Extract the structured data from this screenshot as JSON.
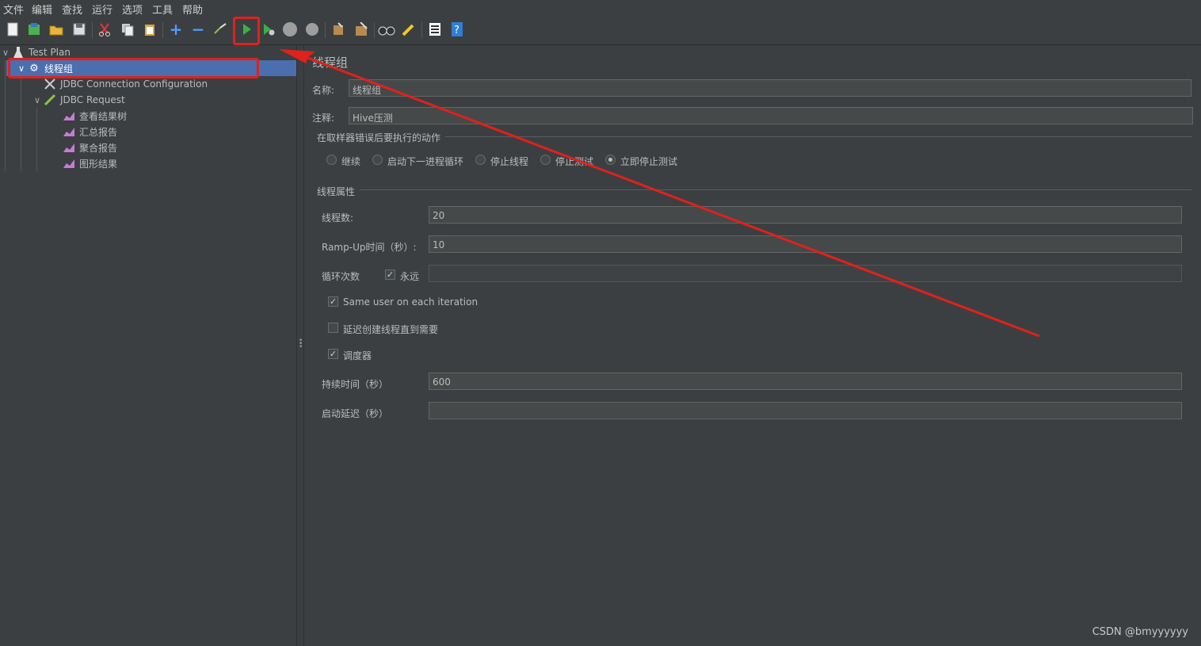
{
  "menu": [
    "文件",
    "编辑",
    "查找",
    "运行",
    "选项",
    "工具",
    "帮助"
  ],
  "tree": {
    "root": "Test Plan",
    "thread_group": "线程组",
    "jdbc_config": "JDBC Connection Configuration",
    "jdbc_request": "JDBC Request",
    "listeners": [
      "查看结果树",
      "汇总报告",
      "聚合报告",
      "图形结果"
    ]
  },
  "panel": {
    "title": "线程组",
    "name_label": "名称:",
    "name_value": "线程组",
    "comment_label": "注释:",
    "comment_value": "Hive压测",
    "error_action_label": "在取样器错误后要执行的动作",
    "error_actions": [
      "继续",
      "启动下一进程循环",
      "停止线程",
      "停止测试",
      "立即停止测试"
    ],
    "error_action_selected": "立即停止测试",
    "thread_props_label": "线程属性",
    "threads_label": "线程数:",
    "threads_value": "20",
    "rampup_label": "Ramp-Up时间（秒）:",
    "rampup_value": "10",
    "loop_label": "循环次数",
    "forever_label": "永远",
    "forever_checked": true,
    "loop_value": "",
    "same_user_label": "Same user on each iteration",
    "same_user_checked": true,
    "delay_create_label": "延迟创建线程直到需要",
    "delay_create_checked": false,
    "scheduler_label": "调度器",
    "scheduler_checked": true,
    "duration_label": "持续时间（秒）",
    "duration_value": "600",
    "startup_delay_label": "启动延迟（秒）",
    "startup_delay_value": ""
  },
  "colors": {
    "annotation": "#e0211c",
    "selection": "#4b6eaf",
    "start_green": "#3cb043"
  },
  "watermark": "CSDN @bmyyyyyy"
}
